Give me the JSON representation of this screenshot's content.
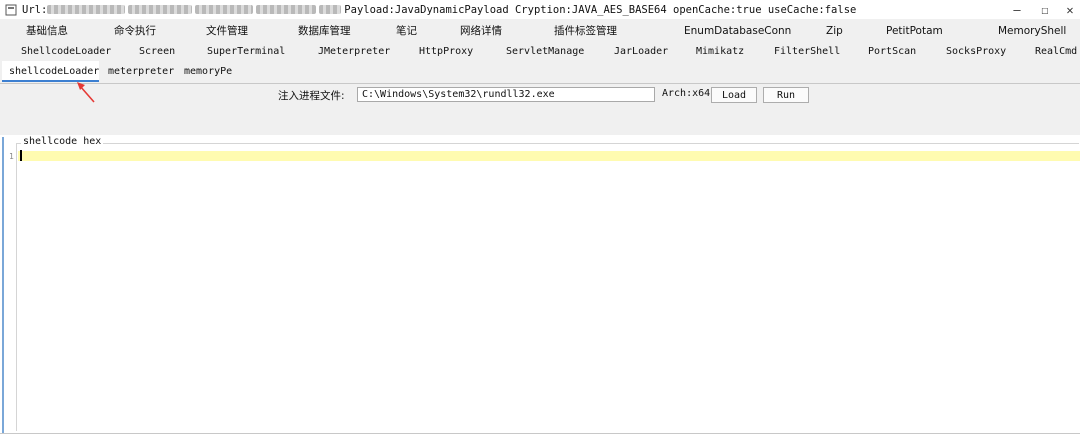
{
  "titlebar": {
    "url_label": "Url:",
    "payload_info": "Payload:JavaDynamicPayload Cryption:JAVA_AES_BASE64 openCache:true useCache:false",
    "minimize_glyph": "—",
    "maximize_glyph": "☐",
    "close_glyph": "✕"
  },
  "tabs_row1": [
    "基础信息",
    "命令执行",
    "文件管理",
    "数据库管理",
    "笔记",
    "网络详情",
    "插件标签管理",
    "EnumDatabaseConn",
    "Zip",
    "PetitPotam",
    "MemoryShell"
  ],
  "tabs_row2": [
    "ShellcodeLoader",
    "Screen",
    "SuperTerminal",
    "JMeterpreter",
    "HttpProxy",
    "ServletManage",
    "JarLoader",
    "Mimikatz",
    "FilterShell",
    "PortScan",
    "SocksProxy",
    "RealCmd"
  ],
  "subtabs": [
    "shellcodeLoader",
    "meterpreter",
    "memoryPe"
  ],
  "loader": {
    "inject_label": "注入进程文件:",
    "path_value": "C:\\Windows\\System32\\rundll32.exe",
    "arch_label": "Arch:x64",
    "load_label": "Load",
    "run_label": "Run"
  },
  "editor": {
    "title": "shellcode hex",
    "line_number": "1"
  },
  "colors": {
    "accent": "#3c7fd1",
    "current_line": "#fffbb0",
    "arrow": "#e53935"
  }
}
